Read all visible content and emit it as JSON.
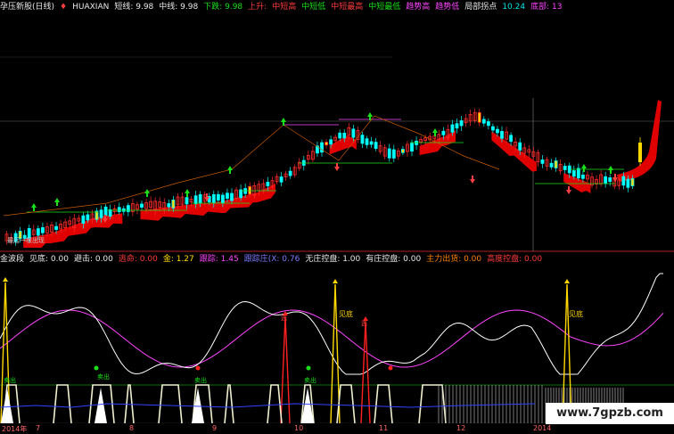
{
  "top_bar": [
    {
      "text": "孕压新股(日线)",
      "color": "white"
    },
    {
      "text": "♦",
      "color": "red"
    },
    {
      "text": "HUAXIAN",
      "color": "white"
    },
    {
      "text": "短线: 9.98",
      "color": "white"
    },
    {
      "text": "中线: 9.98",
      "color": "white"
    },
    {
      "text": "下跌: 9.98",
      "color": "green"
    },
    {
      "text": "上升:",
      "color": "red"
    },
    {
      "text": "中短高",
      "color": "red"
    },
    {
      "text": "中短低",
      "color": "green"
    },
    {
      "text": "中短最高",
      "color": "red"
    },
    {
      "text": "中短最低",
      "color": "green"
    },
    {
      "text": "趋势高",
      "color": "magenta"
    },
    {
      "text": "趋势低",
      "color": "magenta"
    },
    {
      "text": "局部拐点",
      "color": "white"
    },
    {
      "text": "10.24",
      "color": "cyan"
    },
    {
      "text": "底部: 13",
      "color": "magenta"
    }
  ],
  "mid_bar": [
    {
      "text": "金波段",
      "color": "white"
    },
    {
      "text": "见底: 0.00",
      "color": "white"
    },
    {
      "text": "避击: 0.00",
      "color": "white"
    },
    {
      "text": "逃命: 0.00",
      "color": "red"
    },
    {
      "text": "金: 1.27",
      "color": "yellow"
    },
    {
      "text": "跟踪: 1.45",
      "color": "magenta"
    },
    {
      "text": "跟踪庄(X: 0.76",
      "color": "blue"
    },
    {
      "text": "无庄控盘: 1.00",
      "color": "white"
    },
    {
      "text": "有庄控盘: 0.00",
      "color": "white"
    },
    {
      "text": "主力出货: 0.00",
      "color": "orange"
    },
    {
      "text": "高度控盘: 0.00",
      "color": "red"
    }
  ],
  "annotations": {
    "bottom_low_label": "最后一根出现",
    "sell_label": "卖出",
    "bottom_label": "见底",
    "escape_label": "逃"
  },
  "x_axis": [
    "2014年",
    "7",
    "8",
    "9",
    "10",
    "11",
    "12",
    "2014"
  ],
  "watermark": "www.7gpzb.com",
  "colors": {
    "up": "#ff2a2a",
    "down": "#00ffff",
    "ribbon": "#e00000",
    "k_line": "#ffffff",
    "d_line": "#ff44ff"
  }
}
